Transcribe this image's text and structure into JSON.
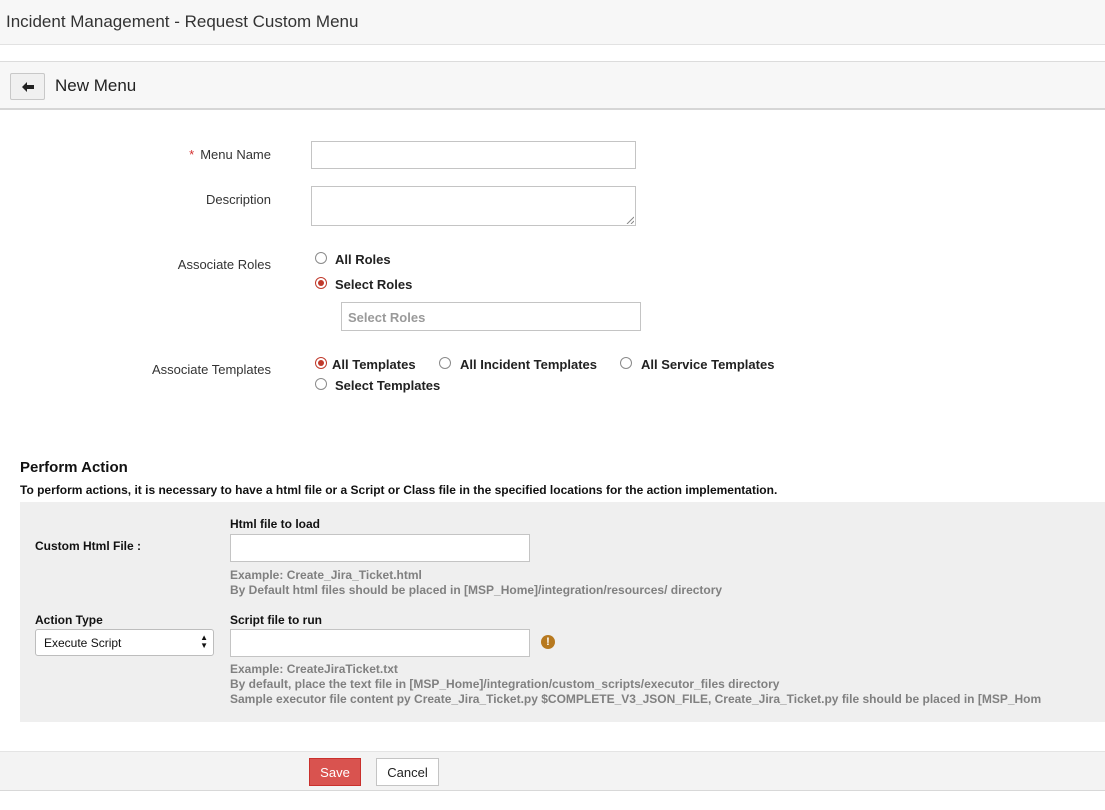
{
  "app": {
    "title": "Incident Management - Request Custom Menu"
  },
  "header": {
    "page_title": "New Menu",
    "back_icon": "arrow-left-icon"
  },
  "form": {
    "menu_name": {
      "label": "Menu Name",
      "required_mark": "*",
      "value": ""
    },
    "description": {
      "label": "Description",
      "value": ""
    },
    "associate_roles": {
      "label": "Associate Roles",
      "options": [
        "All Roles",
        "Select Roles"
      ],
      "selected": "Select Roles",
      "roles_placeholder": "Select Roles"
    },
    "associate_templates": {
      "label": "Associate Templates",
      "options": [
        "All Templates",
        "All Incident Templates",
        "All Service Templates",
        "Select Templates"
      ],
      "selected": "All Templates"
    }
  },
  "perform_action": {
    "title": "Perform Action",
    "note": "To perform actions, it is necessary to have a html file or a Script or Class file in the specified locations for the action implementation.",
    "custom_html": {
      "label": "Custom Html File :",
      "field_label": "Html file to load",
      "value": "",
      "example": "Example: Create_Jira_Ticket.html",
      "location_hint": "By Default html files should be placed in [MSP_Home]/integration/resources/ directory"
    },
    "action_type": {
      "label": "Action Type",
      "selected": "Execute Script",
      "field_label": "Script file to run",
      "value": "",
      "warning_icon": "exclamation-circle-icon",
      "warning_glyph": "!",
      "example": "Example: CreateJiraTicket.txt",
      "location_hint": "By default, place the text file in [MSP_Home]/integration/custom_scripts/executor_files directory",
      "sample_hint": "Sample executor file content py Create_Jira_Ticket.py $COMPLETE_V3_JSON_FILE, Create_Jira_Ticket.py file should be placed in [MSP_Hom"
    }
  },
  "footer": {
    "save_label": "Save",
    "cancel_label": "Cancel"
  },
  "colors": {
    "accent": "#d9534f",
    "required": "#d32f2f",
    "warning": "#b7791f",
    "panel": "#efefef"
  }
}
